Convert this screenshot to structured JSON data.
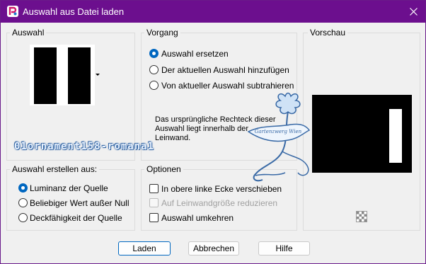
{
  "window": {
    "title": "Auswahl aus Datei laden"
  },
  "auswahl": {
    "label": "Auswahl"
  },
  "vorgang": {
    "label": "Vorgang",
    "options": [
      {
        "label": "Auswahl ersetzen",
        "checked": true
      },
      {
        "label": "Der aktuellen Auswahl hinzufügen",
        "checked": false
      },
      {
        "label": "Von aktueller Auswahl subtrahieren",
        "checked": false
      }
    ],
    "info_text": "Das ursprüngliche Rechteck dieser Auswahl liegt innerhalb der Leinwand."
  },
  "vorschau": {
    "label": "Vorschau"
  },
  "erstellen": {
    "label": "Auswahl erstellen aus:",
    "options": [
      {
        "label": "Luminanz der Quelle",
        "checked": true
      },
      {
        "label": "Beliebiger Wert außer Null",
        "checked": false
      },
      {
        "label": "Deckfähigkeit der Quelle",
        "checked": false
      }
    ]
  },
  "optionen": {
    "label": "Optionen",
    "checks": [
      {
        "label": "In obere linke Ecke verschieben",
        "checked": false,
        "disabled": false
      },
      {
        "label": "Auf Leinwandgröße reduzieren",
        "checked": false,
        "disabled": true
      },
      {
        "label": "Auswahl umkehren",
        "checked": false,
        "disabled": false
      }
    ]
  },
  "watermark": {
    "text": "01ornament158-romana1"
  },
  "logo": {
    "text_line1": "Gartenzwerg Wien"
  },
  "buttons": {
    "load": "Laden",
    "cancel": "Abbrechen",
    "help": "Hilfe"
  },
  "colors": {
    "titlebar": "#6c0f8e",
    "accent": "#0067c0",
    "logo": "#3a6aa6"
  }
}
